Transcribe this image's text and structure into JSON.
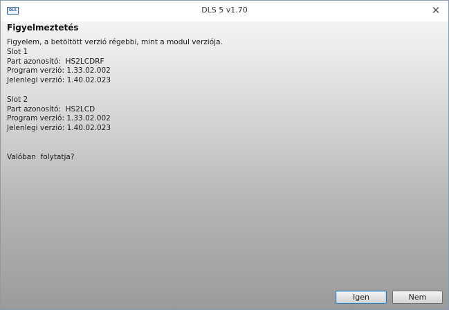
{
  "window": {
    "title": "DLS 5 v1.70",
    "logo_text": "DLS",
    "close_glyph": "✕"
  },
  "dialog": {
    "heading": "Figyelmeztetés",
    "lines": [
      "Figyelem, a betöltött verzió régebbi, mint a modul verziója.",
      "Slot 1",
      "Part azonosító:  HS2LCDRF",
      "Program verzió: 1.33.02.002",
      "Jelenlegi verzió: 1.40.02.023",
      "",
      "Slot 2",
      "Part azonosító:  HS2LCD",
      "Program verzió: 1.33.02.002",
      "Jelenlegi verzió: 1.40.02.023",
      "",
      "",
      "Valóban  folytatja?"
    ]
  },
  "buttons": {
    "yes_label": "Igen",
    "no_label": "Nem"
  },
  "colors": {
    "accent_border": "#3c7fb1",
    "window_border": "#8a9bb0"
  }
}
